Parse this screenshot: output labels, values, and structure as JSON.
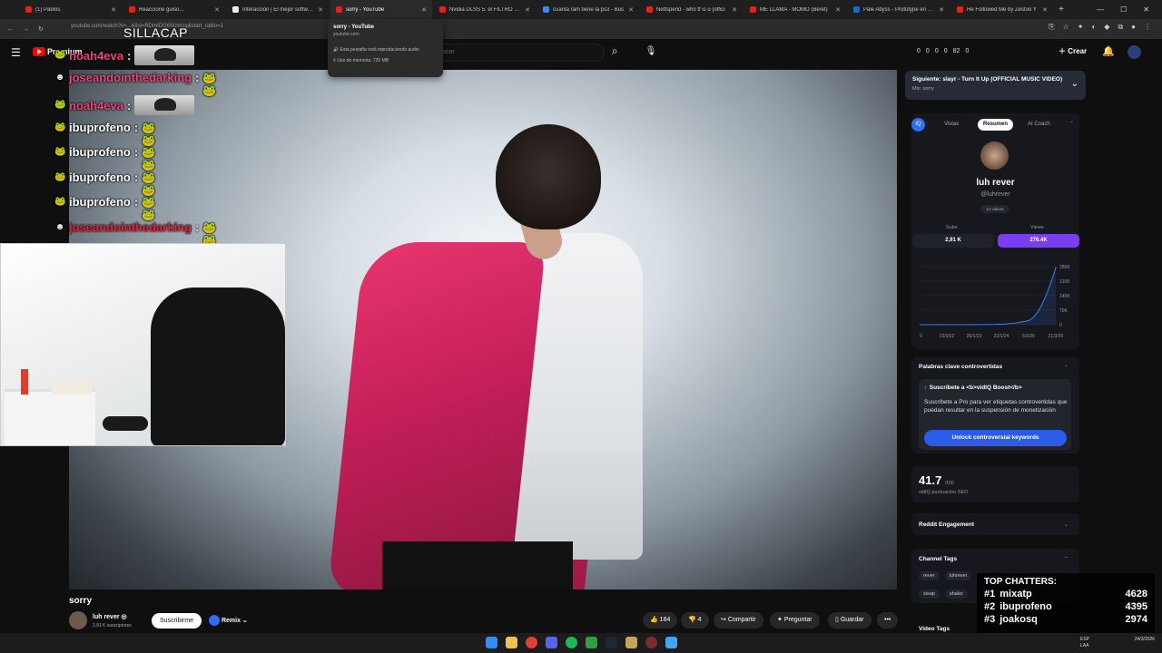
{
  "browser": {
    "tabs": [
      {
        "label": "(1) Pablos",
        "color": "#e62117"
      },
      {
        "label": "Reaccione guiso...",
        "color": "#e62117"
      },
      {
        "label": "Interacción | El mejor software",
        "color": "#eeeeee"
      },
      {
        "label": "sorry - YouTube",
        "color": "#e62117",
        "active": true
      },
      {
        "label": "Nvidia DLSS 5: el FILTRO DE L",
        "color": "#e62117"
      },
      {
        "label": "cuanta ram tiene la ps3 - Bus",
        "color": "#4285f4"
      },
      {
        "label": "Nettspend - who tf is u (offici",
        "color": "#e62117"
      },
      {
        "label": "ME LLAMA - MOMO (Beret)",
        "color": "#e62117"
      },
      {
        "label": "Pale Abyss - Prototype en Ste",
        "color": "#1b6ac9"
      },
      {
        "label": "He Followed Me by Zestoo Y",
        "color": "#e62117"
      }
    ],
    "new_tab": "+",
    "url": "youtube.com/watch?v=...&list=RDmIDG6Sizmzg&start_radio=1",
    "tab_tooltip": {
      "title": "sorry - YouTube",
      "domain": "youtube.com",
      "audio": "Esta pestaña está reproduciendo audio",
      "memory": "Uso de memoria: 720 MB"
    }
  },
  "yt_header": {
    "premium": "Premium",
    "search_placeholder": "Buscar",
    "create_label": "Crear",
    "vidiq_counts": [
      "0",
      "0",
      "0",
      "0",
      "82",
      "0"
    ]
  },
  "overlay": {
    "title": "SILLACAP",
    "chat": [
      {
        "user": "noah4eva",
        "sep": ":",
        "color": "#e8457d",
        "badge": "🐸",
        "emote": "img"
      },
      {
        "user": "joseandointhedarking",
        "sep": ":",
        "color": "#e8457d",
        "badge": "☻",
        "emote": "🐸🐸"
      },
      {
        "user": "noah4eva",
        "sep": ":",
        "color": "#e8457d",
        "badge": "🐸",
        "emote": "img"
      },
      {
        "user": "ibuprofeno",
        "sep": ":",
        "color": "#ffffff",
        "badge": "🐸",
        "emote": "🐸🐸"
      },
      {
        "user": "ibuprofeno",
        "sep": ":",
        "color": "#ffffff",
        "badge": "🐸",
        "emote": "🐸🐸"
      },
      {
        "user": "ibuprofeno",
        "sep": ":",
        "color": "#ffffff",
        "badge": "🐸",
        "emote": "🐸🐸"
      },
      {
        "user": "ibuprofeno",
        "sep": ":",
        "color": "#ffffff",
        "badge": "🐸",
        "emote": "🐸🐸"
      },
      {
        "user": "joseandointhedarking",
        "sep": ":",
        "color": "#e0253b",
        "badge": "☻",
        "emote": "🐸🐸"
      }
    ],
    "top_chatters": {
      "heading": "TOP CHATTERS:",
      "rows": [
        {
          "rank": "#1",
          "name": "mixatp",
          "count": "4628"
        },
        {
          "rank": "#2",
          "name": "ibuprofeno",
          "count": "4395"
        },
        {
          "rank": "#3",
          "name": "joakosq",
          "count": "2974"
        }
      ]
    }
  },
  "video": {
    "title": "sorry",
    "channel": "luh rever",
    "subs": "2,91 K suscriptores",
    "subscribe": "Suscribirme",
    "remix": "Remix",
    "likes": "184",
    "dislikes": "4",
    "share": "Compartir",
    "ask": "Preguntar",
    "save": "Guardar",
    "more": "•••"
  },
  "upnext": {
    "title": "Siguiente: slayr - Turn It Up (OFFICIAL MUSIC VIDEO)",
    "sub": "Mix: sorry"
  },
  "vidiq": {
    "logo": "IQ",
    "tabs": [
      "Vistas",
      "Resumen",
      "AI Coach"
    ],
    "active_tab": "Resumen",
    "channel_name": "luh rever",
    "handle": "@luhrever",
    "videos": "12 videos",
    "subs_label": "Subs",
    "views_label": "Views",
    "subs_value": "2,91 K",
    "views_value": "276.4K",
    "accent": "#7b3df2",
    "controversial": {
      "heading": "Palabras clave controvertidas",
      "card_title": "Suscríbete a <b>vidIQ Boost</b>",
      "card_text": "Suscríbete a Pro para ver etiquetas controvertidas que puedan resultar en la suspensión de monetización",
      "cta": "Unlock controversial keywords"
    },
    "score": {
      "value": "41.7",
      "suffix": "/100",
      "label": "vidIQ puntuación SEO"
    },
    "reddit": "Reddit Engagement",
    "channel_tags": {
      "heading": "Channel Tags",
      "tags": [
        "rever",
        "luhrever",
        "sixap",
        "shako"
      ]
    },
    "video_tags": "Video Tags"
  },
  "chart_data": {
    "type": "line",
    "x": [
      "13/3/22",
      "26/1/23",
      "22/1/24",
      "5/3/25",
      "21/3/26"
    ],
    "series": [
      {
        "values": [
          0,
          0,
          2,
          18,
          276
        ]
      }
    ],
    "y_ticks": [
      "280K",
      "210K",
      "140K",
      "70K",
      "0"
    ],
    "ylim": [
      0,
      280
    ],
    "x_ticks": [
      "0",
      "13/3/22",
      "26/1/23",
      "22/1/24",
      "5/3/25",
      "21/3/26"
    ],
    "color": "#3d7cf0"
  },
  "taskbar": {
    "lang": "ESP\nLAA",
    "time": "24/3/2026"
  }
}
